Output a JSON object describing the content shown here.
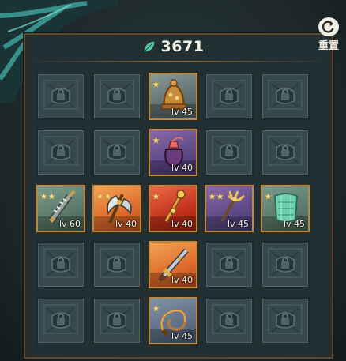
{
  "currency": {
    "amount": "3671",
    "icon": "leaf-icon",
    "color": "#55c9a6"
  },
  "reset_button": {
    "label": "重置",
    "icon": "refresh-icon"
  },
  "grid": {
    "rows": [
      [
        {
          "state": "locked"
        },
        {
          "state": "locked"
        },
        {
          "state": "item",
          "name": "bell-item",
          "level": "lv 45",
          "stars": 1,
          "rarity": "gray"
        },
        {
          "state": "locked"
        },
        {
          "state": "locked"
        }
      ],
      [
        {
          "state": "locked"
        },
        {
          "state": "locked"
        },
        {
          "state": "item",
          "name": "pouch-item",
          "level": "lv 40",
          "stars": 1,
          "rarity": "purple"
        },
        {
          "state": "locked"
        },
        {
          "state": "locked"
        }
      ],
      [
        {
          "state": "item",
          "name": "spiked-club-item",
          "level": "lv 60",
          "stars": 2,
          "rarity": "green"
        },
        {
          "state": "item",
          "name": "battle-axe-item",
          "level": "lv 40",
          "stars": 2,
          "rarity": "orange"
        },
        {
          "state": "item",
          "name": "scepter-item",
          "level": "lv 40",
          "stars": 1,
          "rarity": "red"
        },
        {
          "state": "item",
          "name": "trident-item",
          "level": "lv 45",
          "stars": 2,
          "rarity": "purple"
        },
        {
          "state": "item",
          "name": "jade-armor-item",
          "level": "lv 45",
          "stars": 1,
          "rarity": "green"
        }
      ],
      [
        {
          "state": "locked"
        },
        {
          "state": "locked"
        },
        {
          "state": "item",
          "name": "sword-item",
          "level": "lv 40",
          "stars": 0,
          "rarity": "orange"
        },
        {
          "state": "locked"
        },
        {
          "state": "locked"
        }
      ],
      [
        {
          "state": "locked"
        },
        {
          "state": "locked"
        },
        {
          "state": "item",
          "name": "whip-item",
          "level": "lv 45",
          "stars": 1,
          "rarity": "blue"
        },
        {
          "state": "locked"
        },
        {
          "state": "locked"
        }
      ]
    ]
  }
}
